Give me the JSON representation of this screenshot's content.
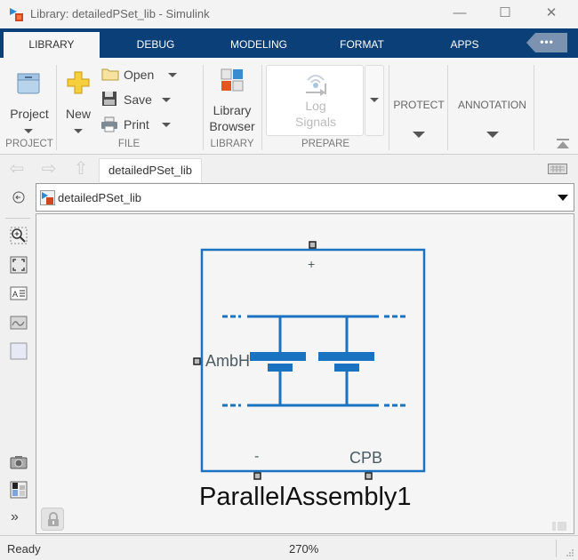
{
  "window": {
    "title": "Library: detailedPSet_lib - Simulink",
    "controls": {
      "minimize": "—",
      "maximize": "☐",
      "close": "✕"
    }
  },
  "tabs": [
    {
      "label": "LIBRARY",
      "active": true
    },
    {
      "label": "DEBUG",
      "active": false
    },
    {
      "label": "MODELING",
      "active": false
    },
    {
      "label": "FORMAT",
      "active": false
    },
    {
      "label": "APPS",
      "active": false
    }
  ],
  "more_tabs_label": "•••",
  "ribbon": {
    "project": {
      "button_label": "Project",
      "group_label": "PROJECT"
    },
    "file": {
      "new_label": "New",
      "open_label": "Open",
      "save_label": "Save",
      "print_label": "Print",
      "group_label": "FILE"
    },
    "library": {
      "button_label_line1": "Library",
      "button_label_line2": "Browser",
      "group_label": "LIBRARY"
    },
    "prepare": {
      "log_signals_line1": "Log",
      "log_signals_line2": "Signals",
      "group_label": "PREPARE"
    },
    "protect": {
      "label": "PROTECT"
    },
    "annotation": {
      "label": "ANNOTATION"
    }
  },
  "navigation": {
    "file_tab": "detailedPSet_lib",
    "address": "detailedPSet_lib"
  },
  "block": {
    "name": "ParallelAssembly1",
    "ports": {
      "top": "+",
      "left": "AmbH",
      "bottom_left": "-",
      "bottom_right": "CPB"
    },
    "color": "#1a73c0"
  },
  "status": {
    "text": "Ready",
    "zoom": "270%"
  }
}
